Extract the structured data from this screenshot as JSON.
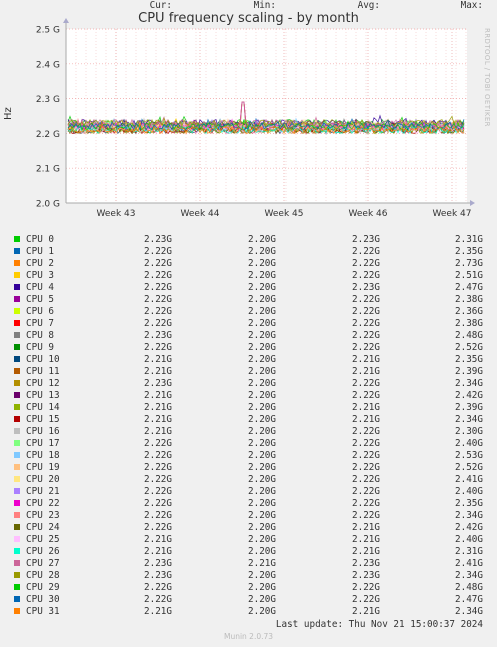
{
  "chart_data": {
    "type": "line",
    "title": "CPU frequency scaling - by month",
    "ylabel": "Hz",
    "y_ticks": [
      "2.5 G",
      "2.4 G",
      "2.3 G",
      "2.2 G",
      "2.1 G",
      "2.0 G"
    ],
    "ylim": [
      2.0,
      2.5
    ],
    "x_ticks": [
      "Week 43",
      "Week 44",
      "Week 45",
      "Week 46",
      "Week 47"
    ],
    "grid": true,
    "side_label": "RRDTOOL / TOBI OETIKER",
    "columns": {
      "cur": "Cur:",
      "min": "Min:",
      "avg": "Avg:",
      "max": "Max:"
    },
    "series": [
      {
        "name": "CPU 0",
        "color": "#00cc00",
        "cur": "2.23G",
        "min": "2.20G",
        "avg": "2.23G",
        "max": "2.31G"
      },
      {
        "name": "CPU 1",
        "color": "#0066b3",
        "cur": "2.22G",
        "min": "2.20G",
        "avg": "2.22G",
        "max": "2.35G"
      },
      {
        "name": "CPU 2",
        "color": "#ff8000",
        "cur": "2.22G",
        "min": "2.20G",
        "avg": "2.22G",
        "max": "2.73G"
      },
      {
        "name": "CPU 3",
        "color": "#ffcc00",
        "cur": "2.22G",
        "min": "2.20G",
        "avg": "2.22G",
        "max": "2.51G"
      },
      {
        "name": "CPU 4",
        "color": "#330099",
        "cur": "2.22G",
        "min": "2.20G",
        "avg": "2.23G",
        "max": "2.47G"
      },
      {
        "name": "CPU 5",
        "color": "#990099",
        "cur": "2.22G",
        "min": "2.20G",
        "avg": "2.22G",
        "max": "2.38G"
      },
      {
        "name": "CPU 6",
        "color": "#ccff00",
        "cur": "2.22G",
        "min": "2.20G",
        "avg": "2.22G",
        "max": "2.36G"
      },
      {
        "name": "CPU 7",
        "color": "#ff0000",
        "cur": "2.22G",
        "min": "2.20G",
        "avg": "2.22G",
        "max": "2.38G"
      },
      {
        "name": "CPU 8",
        "color": "#808080",
        "cur": "2.23G",
        "min": "2.20G",
        "avg": "2.22G",
        "max": "2.48G"
      },
      {
        "name": "CPU 9",
        "color": "#008f00",
        "cur": "2.22G",
        "min": "2.20G",
        "avg": "2.22G",
        "max": "2.52G"
      },
      {
        "name": "CPU 10",
        "color": "#00487d",
        "cur": "2.21G",
        "min": "2.20G",
        "avg": "2.21G",
        "max": "2.35G"
      },
      {
        "name": "CPU 11",
        "color": "#b35a00",
        "cur": "2.21G",
        "min": "2.20G",
        "avg": "2.21G",
        "max": "2.39G"
      },
      {
        "name": "CPU 12",
        "color": "#b38f00",
        "cur": "2.23G",
        "min": "2.20G",
        "avg": "2.22G",
        "max": "2.34G"
      },
      {
        "name": "CPU 13",
        "color": "#6b006b",
        "cur": "2.21G",
        "min": "2.20G",
        "avg": "2.22G",
        "max": "2.42G"
      },
      {
        "name": "CPU 14",
        "color": "#8fb300",
        "cur": "2.21G",
        "min": "2.20G",
        "avg": "2.21G",
        "max": "2.39G"
      },
      {
        "name": "CPU 15",
        "color": "#b30000",
        "cur": "2.21G",
        "min": "2.20G",
        "avg": "2.21G",
        "max": "2.34G"
      },
      {
        "name": "CPU 16",
        "color": "#bebebe",
        "cur": "2.21G",
        "min": "2.20G",
        "avg": "2.22G",
        "max": "2.30G"
      },
      {
        "name": "CPU 17",
        "color": "#80ff80",
        "cur": "2.22G",
        "min": "2.20G",
        "avg": "2.22G",
        "max": "2.40G"
      },
      {
        "name": "CPU 18",
        "color": "#80c9ff",
        "cur": "2.22G",
        "min": "2.20G",
        "avg": "2.22G",
        "max": "2.53G"
      },
      {
        "name": "CPU 19",
        "color": "#ffc080",
        "cur": "2.22G",
        "min": "2.20G",
        "avg": "2.22G",
        "max": "2.52G"
      },
      {
        "name": "CPU 20",
        "color": "#ffe680",
        "cur": "2.22G",
        "min": "2.20G",
        "avg": "2.22G",
        "max": "2.41G"
      },
      {
        "name": "CPU 21",
        "color": "#aa80ff",
        "cur": "2.22G",
        "min": "2.20G",
        "avg": "2.22G",
        "max": "2.40G"
      },
      {
        "name": "CPU 22",
        "color": "#ee00cc",
        "cur": "2.22G",
        "min": "2.20G",
        "avg": "2.22G",
        "max": "2.35G"
      },
      {
        "name": "CPU 23",
        "color": "#ff8080",
        "cur": "2.22G",
        "min": "2.20G",
        "avg": "2.22G",
        "max": "2.34G"
      },
      {
        "name": "CPU 24",
        "color": "#666600",
        "cur": "2.22G",
        "min": "2.20G",
        "avg": "2.21G",
        "max": "2.42G"
      },
      {
        "name": "CPU 25",
        "color": "#ffbfff",
        "cur": "2.21G",
        "min": "2.20G",
        "avg": "2.21G",
        "max": "2.40G"
      },
      {
        "name": "CPU 26",
        "color": "#00ffcc",
        "cur": "2.21G",
        "min": "2.20G",
        "avg": "2.21G",
        "max": "2.31G"
      },
      {
        "name": "CPU 27",
        "color": "#cc6699",
        "cur": "2.23G",
        "min": "2.21G",
        "avg": "2.23G",
        "max": "2.41G"
      },
      {
        "name": "CPU 28",
        "color": "#999900",
        "cur": "2.23G",
        "min": "2.20G",
        "avg": "2.23G",
        "max": "2.34G"
      },
      {
        "name": "CPU 29",
        "color": "#00cc00",
        "cur": "2.22G",
        "min": "2.20G",
        "avg": "2.22G",
        "max": "2.48G"
      },
      {
        "name": "CPU 30",
        "color": "#0066b3",
        "cur": "2.22G",
        "min": "2.20G",
        "avg": "2.22G",
        "max": "2.47G"
      },
      {
        "name": "CPU 31",
        "color": "#ff8000",
        "cur": "2.21G",
        "min": "2.20G",
        "avg": "2.21G",
        "max": "2.34G"
      }
    ]
  },
  "footer": {
    "last_update": "Last update: Thu Nov 21 15:00:37 2024",
    "version": "Munin 2.0.73"
  }
}
